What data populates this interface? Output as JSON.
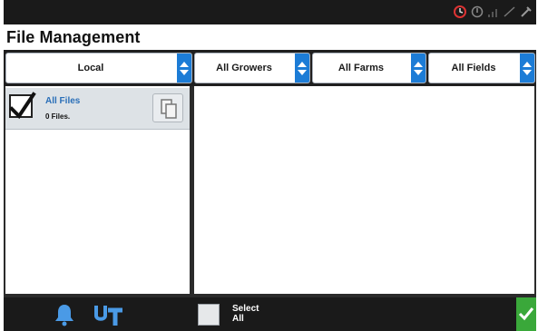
{
  "window": {
    "title": "File Management"
  },
  "status_icons": [
    "timer-icon",
    "info-icon",
    "signal-icon",
    "gps-icon",
    "tool-icon"
  ],
  "filters": {
    "source": "Local",
    "growers": "All Growers",
    "farms": "All Farms",
    "fields": "All Fields"
  },
  "file_list": [
    {
      "title": "All Files",
      "subtitle": "0 Files.",
      "checked": true
    }
  ],
  "bottom": {
    "select_all_line1": "Select",
    "select_all_line2": "All",
    "icons": [
      "bell-icon",
      "ut-icon",
      "checkmark-icon"
    ]
  },
  "colors": {
    "accent_blue": "#1c7cd6",
    "confirm_green": "#3aa83a",
    "background_dark": "#1a1a1a",
    "item_title_blue": "#2a6fb8"
  }
}
